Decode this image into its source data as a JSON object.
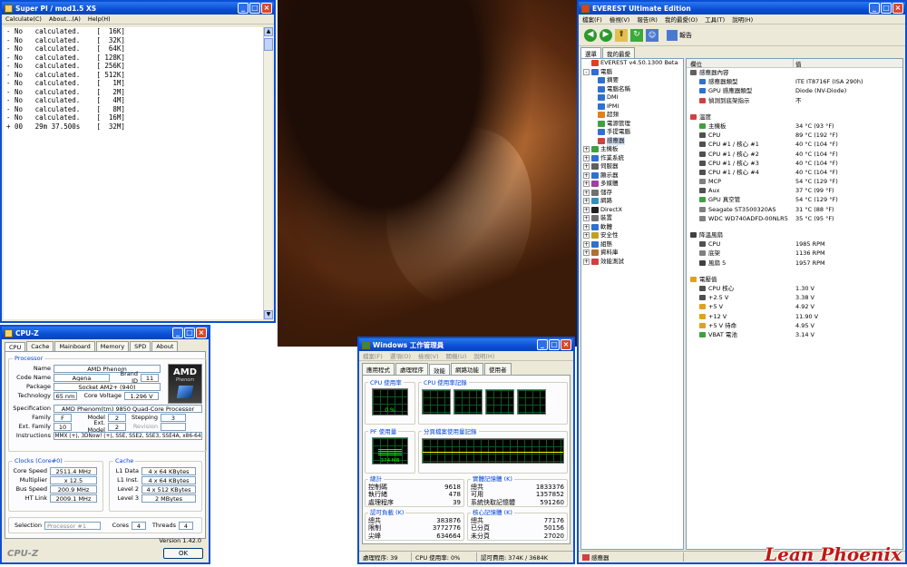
{
  "superpi": {
    "title": "Super PI / mod1.5 XS",
    "menu": [
      "Calculate(C)",
      "About...(A)",
      "Help(H)"
    ],
    "lines": [
      "- No   calculated.    [  16K]",
      "- No   calculated.    [  32K]",
      "- No   calculated.    [  64K]",
      "- No   calculated.    [ 128K]",
      "- No   calculated.    [ 256K]",
      "- No   calculated.    [ 512K]",
      "- No   calculated.    [   1M]",
      "- No   calculated.    [   2M]",
      "- No   calculated.    [   4M]",
      "- No   calculated.    [   8M]",
      "- No   calculated.    [  16M]",
      "+ 00   29m 37.500s    [  32M]"
    ]
  },
  "cpuz": {
    "title": "CPU-Z",
    "tabs": [
      "CPU",
      "Cache",
      "Mainboard",
      "Memory",
      "SPD",
      "About"
    ],
    "processor_legend": "Processor",
    "name_label": "Name",
    "name": "AMD Phenom",
    "codename_label": "Code Name",
    "codename": "Agena",
    "brandid_label": "Brand ID",
    "brandid": "11",
    "package_label": "Package",
    "package": "Socket AM2+ (940)",
    "tech_label": "Technology",
    "tech": "65 nm",
    "voltage_label": "Core Voltage",
    "voltage": "1.296 V",
    "spec_label": "Specification",
    "spec": "AMD Phenom(tm) 9850 Quad-Core Processor",
    "family_label": "Family",
    "family": "F",
    "model_label": "Model",
    "model": "2",
    "stepping_label": "Stepping",
    "stepping": "3",
    "extfamily_label": "Ext. Family",
    "extfamily": "10",
    "extmodel_label": "Ext. Model",
    "extmodel": "2",
    "revision_label": "Revision",
    "revision": "",
    "instr_label": "Instructions",
    "instr": "MMX (+), 3DNow! (+), SSE, SSE2, SSE3, SSE4A, x86-64",
    "clocks_legend": "Clocks (Core#0)",
    "corespeed_label": "Core Speed",
    "corespeed": "2511.4 MHz",
    "mult_label": "Multiplier",
    "mult": "x 12.5",
    "bus_label": "Bus Speed",
    "bus": "200.9 MHz",
    "ht_label": "HT Link",
    "ht": "2009.1 MHz",
    "cache_legend": "Cache",
    "l1d_label": "L1 Data",
    "l1d": "4 x 64 KBytes",
    "l1i_label": "L1 Inst.",
    "l1i": "4 x 64 KBytes",
    "l2_label": "Level 2",
    "l2": "4 x 512 KBytes",
    "l3_label": "Level 3",
    "l3": "2 MBytes",
    "selection_label": "Selection",
    "selection": "Processor #1",
    "cores_label": "Cores",
    "cores": "4",
    "threads_label": "Threads",
    "threads": "4",
    "version": "Version 1.42.0",
    "footer_logo": "CPU-Z",
    "ok": "OK",
    "logo_brand": "AMD",
    "logo_sub": "Phenom"
  },
  "taskmgr": {
    "title": "Windows 工作管理員",
    "menu": [
      "檔案(F)",
      "選項(O)",
      "檢視(V)",
      "關機(U)",
      "說明(H)"
    ],
    "tabs": [
      "應用程式",
      "處理程序",
      "效能",
      "網路功能",
      "使用者"
    ],
    "cpu_usage_label": "CPU 使用率",
    "cpu_usage": "0 %",
    "cpu_history_label": "CPU 使用率記錄",
    "pf_label": "PF 使用量",
    "pf_value": "374 MB",
    "pf_history_label": "分頁檔案使用量記錄",
    "totals_legend": "總計",
    "handles_label": "控制碼",
    "handles": "9618",
    "threads_label": "執行緒",
    "threads": "478",
    "processes_label": "處理程序",
    "processes": "39",
    "physmem_legend": "實體記憶體 (K)",
    "pm_total_label": "總共",
    "pm_total": "1833376",
    "pm_avail_label": "可用",
    "pm_avail": "1357852",
    "pm_cache_label": "系統快取記憶體",
    "pm_cache": "591260",
    "commit_legend": "認可負載 (K)",
    "cc_total_label": "總共",
    "cc_total": "383876",
    "cc_limit_label": "限制",
    "cc_limit": "3772776",
    "cc_peak_label": "尖峰",
    "cc_peak": "634664",
    "kernel_legend": "核心記憶體 (K)",
    "km_total_label": "總共",
    "km_total": "77176",
    "km_paged_label": "已分頁",
    "km_paged": "50156",
    "km_nonpaged_label": "未分頁",
    "km_nonpaged": "27020",
    "status_proc": "處理程序: 39",
    "status_cpu": "CPU 使用率: 0%",
    "status_commit": "認可費用: 374K / 3684K"
  },
  "everest": {
    "title": "EVEREST Ultimate Edition",
    "menu": [
      "檔案(F)",
      "檢視(V)",
      "報告(R)",
      "我的最愛(O)",
      "工具(T)",
      "說明(H)"
    ],
    "report_btn": "報告",
    "tree_tabs": [
      "選單",
      "我的最愛"
    ],
    "tree": [
      {
        "label": "EVEREST v4.50.1300 Beta",
        "level": 0,
        "exp": "",
        "color": "#e04020"
      },
      {
        "label": "電腦",
        "level": 0,
        "exp": "-",
        "color": "#3070d0"
      },
      {
        "label": "摘要",
        "level": 2,
        "exp": "",
        "color": "#3070d0"
      },
      {
        "label": "電腦名稱",
        "level": 2,
        "exp": "",
        "color": "#3070d0"
      },
      {
        "label": "DMI",
        "level": 2,
        "exp": "",
        "color": "#3070d0"
      },
      {
        "label": "IPMI",
        "level": 2,
        "exp": "",
        "color": "#3070d0"
      },
      {
        "label": "超頻",
        "level": 2,
        "exp": "",
        "color": "#e08020"
      },
      {
        "label": "電源管理",
        "level": 2,
        "exp": "",
        "color": "#40a040"
      },
      {
        "label": "手提電腦",
        "level": 2,
        "exp": "",
        "color": "#3070d0"
      },
      {
        "label": "感應器",
        "level": 2,
        "exp": "",
        "color": "#d04040"
      },
      {
        "label": "主機板",
        "level": 0,
        "exp": "+",
        "color": "#40a040"
      },
      {
        "label": "作業系統",
        "level": 0,
        "exp": "+",
        "color": "#3070d0"
      },
      {
        "label": "伺服器",
        "level": 0,
        "exp": "+",
        "color": "#606060"
      },
      {
        "label": "顯示器",
        "level": 0,
        "exp": "+",
        "color": "#3070d0"
      },
      {
        "label": "多媒體",
        "level": 0,
        "exp": "+",
        "color": "#a040a0"
      },
      {
        "label": "儲存",
        "level": 0,
        "exp": "+",
        "color": "#707070"
      },
      {
        "label": "網路",
        "level": 0,
        "exp": "+",
        "color": "#3090c0"
      },
      {
        "label": "DirectX",
        "level": 0,
        "exp": "+",
        "color": "#202020"
      },
      {
        "label": "裝置",
        "level": 0,
        "exp": "+",
        "color": "#707070"
      },
      {
        "label": "軟體",
        "level": 0,
        "exp": "+",
        "color": "#3070d0"
      },
      {
        "label": "安全性",
        "level": 0,
        "exp": "+",
        "color": "#c0a020"
      },
      {
        "label": "組態",
        "level": 0,
        "exp": "+",
        "color": "#3070d0"
      },
      {
        "label": "資料庫",
        "level": 0,
        "exp": "+",
        "color": "#b07030"
      },
      {
        "label": "效能測試",
        "level": 0,
        "exp": "+",
        "color": "#d04040"
      }
    ],
    "col_item": "欄位",
    "col_value": "值",
    "rows": [
      {
        "c1": "感應器內容",
        "c2": "",
        "sec": true,
        "color": "#606060"
      },
      {
        "c1": "感應器類型",
        "c2": "ITE IT8716F  (ISA 290h)",
        "color": "#3070d0"
      },
      {
        "c1": "GPU 感應器類型",
        "c2": "Diode  (NV-Diode)",
        "color": "#3070d0"
      },
      {
        "c1": "偵測到底架指示",
        "c2": "不",
        "color": "#d04040"
      },
      {
        "gap": true
      },
      {
        "c1": "溫度",
        "c2": "",
        "sec": true,
        "color": "#d04040"
      },
      {
        "c1": "主機板",
        "c2": "34 °C  (93 °F)",
        "color": "#40a040"
      },
      {
        "c1": "CPU",
        "c2": "89 °C  (192 °F)",
        "color": "#505050"
      },
      {
        "c1": "CPU #1 / 核心 #1",
        "c2": "40 °C  (104 °F)",
        "color": "#505050"
      },
      {
        "c1": "CPU #1 / 核心 #2",
        "c2": "40 °C  (104 °F)",
        "color": "#505050"
      },
      {
        "c1": "CPU #1 / 核心 #3",
        "c2": "40 °C  (104 °F)",
        "color": "#505050"
      },
      {
        "c1": "CPU #1 / 核心 #4",
        "c2": "40 °C  (104 °F)",
        "color": "#505050"
      },
      {
        "c1": "MCP",
        "c2": "54 °C  (129 °F)",
        "color": "#808080"
      },
      {
        "c1": "Aux",
        "c2": "37 °C  (99 °F)",
        "color": "#505050"
      },
      {
        "c1": "GPU 真空管",
        "c2": "54 °C  (129 °F)",
        "color": "#40a040"
      },
      {
        "c1": "Seagate ST3500320AS",
        "c2": "31 °C  (88 °F)",
        "color": "#808080"
      },
      {
        "c1": "WDC WD740ADFD-00NLR5",
        "c2": "35 °C  (95 °F)",
        "color": "#808080"
      },
      {
        "gap": true
      },
      {
        "c1": "降溫風扇",
        "c2": "",
        "sec": true,
        "color": "#404040"
      },
      {
        "c1": "CPU",
        "c2": "1985 RPM",
        "color": "#505050"
      },
      {
        "c1": "底架",
        "c2": "1136 RPM",
        "color": "#808080"
      },
      {
        "c1": "風扇 5",
        "c2": "1957 RPM",
        "color": "#404040"
      },
      {
        "gap": true
      },
      {
        "c1": "電壓值",
        "c2": "",
        "sec": true,
        "color": "#e0a020"
      },
      {
        "c1": "CPU 核心",
        "c2": "1.30 V",
        "color": "#505050"
      },
      {
        "c1": "+2.5 V",
        "c2": "3.38 V",
        "color": "#505050"
      },
      {
        "c1": "+5 V",
        "c2": "4.92 V",
        "color": "#e0a020"
      },
      {
        "c1": "+12 V",
        "c2": "11.90 V",
        "color": "#e0a020"
      },
      {
        "c1": "+5 V 待命",
        "c2": "4.95 V",
        "color": "#e0a020"
      },
      {
        "c1": "VBAT 電池",
        "c2": "3.14 V",
        "color": "#40a040"
      }
    ],
    "status": "感應器"
  },
  "signature": "Lean Phoenix",
  "colors": {
    "titlebar": "#0a4fd4",
    "graph_line": "#00ff00",
    "accent": "#0046d5"
  }
}
